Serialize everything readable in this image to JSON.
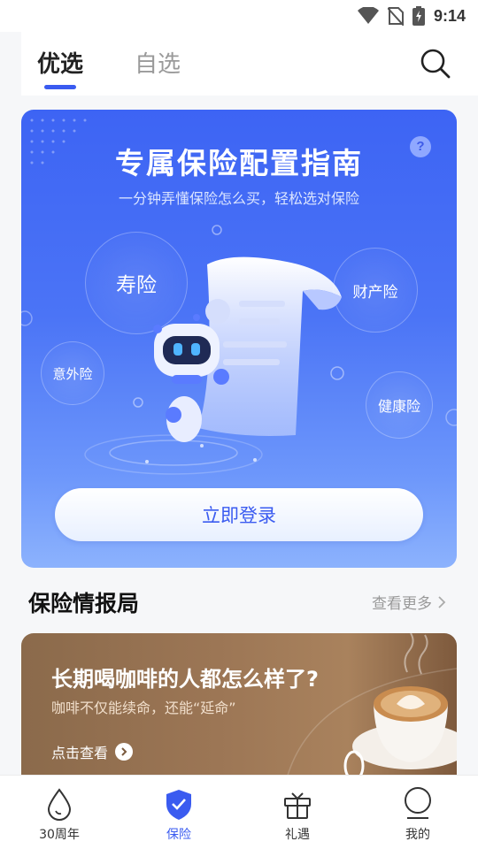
{
  "status_bar": {
    "time": "9:14",
    "icons": [
      "wifi-icon",
      "no-sim-icon",
      "battery-charging-icon"
    ]
  },
  "header": {
    "tabs": [
      {
        "label": "优选",
        "selected": true
      },
      {
        "label": "自选",
        "selected": false
      }
    ],
    "search_icon": "search-icon"
  },
  "hero": {
    "title": "专属保险配置指南",
    "subtitle": "一分钟弄懂保险怎么买，轻松选对保险",
    "help_label": "?",
    "categories": [
      "寿险",
      "财产险",
      "意外险",
      "健康险"
    ],
    "login_button": "立即登录"
  },
  "news_section": {
    "title": "保险情报局",
    "more_label": "查看更多"
  },
  "article": {
    "title": "长期喝咖啡的人都怎么样了?",
    "subtitle": "咖啡不仅能续命，还能“延命”",
    "read_label": "点击查看"
  },
  "bottom_nav": [
    {
      "label": "30周年",
      "icon": "drop-icon",
      "active": false
    },
    {
      "label": "保险",
      "icon": "shield-check-icon",
      "active": true
    },
    {
      "label": "礼遇",
      "icon": "gift-box-icon",
      "active": false
    },
    {
      "label": "我的",
      "icon": "profile-icon",
      "active": false
    }
  ],
  "colors": {
    "accent": "#3a5bf0",
    "hero_top": "#3d64f4",
    "hero_bottom": "#8cb2fd",
    "coffee_card": "#9c7655"
  }
}
